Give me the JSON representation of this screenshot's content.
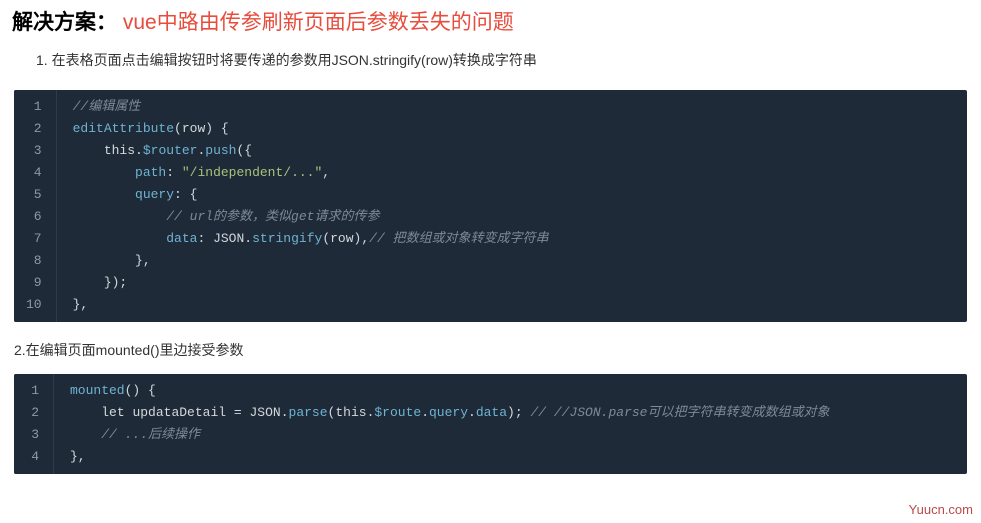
{
  "heading": {
    "prefix": "解决方案：",
    "title": "vue中路由传参刷新页面后参数丢失的问题"
  },
  "steps": {
    "s1": "1. 在表格页面点击编辑按钮时将要传递的参数用JSON.stringify(row)转换成字符串",
    "s2": "2.在编辑页面mounted()里边接受参数"
  },
  "code1": {
    "gutter": [
      "1",
      "2",
      "3",
      "4",
      "5",
      "6",
      "7",
      "8",
      "9",
      "10"
    ],
    "l1_comment": "//编辑属性",
    "l2_func": "editAttribute",
    "l2_param": "row",
    "l3_this": "this",
    "l3_router": "$router",
    "l3_push": "push",
    "l4_key": "path",
    "l4_val": "\"/independent/...\"",
    "l5_key": "query",
    "l6_comment": "// url的参数，类似get请求的传参",
    "l7_key": "data",
    "l7_json": "JSON",
    "l7_stringify": "stringify",
    "l7_arg": "row",
    "l7_comment": "// 把数组或对象转变成字符串"
  },
  "code2": {
    "gutter": [
      "1",
      "2",
      "3",
      "4"
    ],
    "l1_func": "mounted",
    "l2_let": "let",
    "l2_var": "updataDetail",
    "l2_json": "JSON",
    "l2_parse": "parse",
    "l2_this": "this",
    "l2_route": "$route",
    "l2_query": "query",
    "l2_data": "data",
    "l2_comment": "// //JSON.parse可以把字符串转变成数组或对象",
    "l3_comment": "// ...后续操作"
  },
  "watermark": "Yuucn.com"
}
